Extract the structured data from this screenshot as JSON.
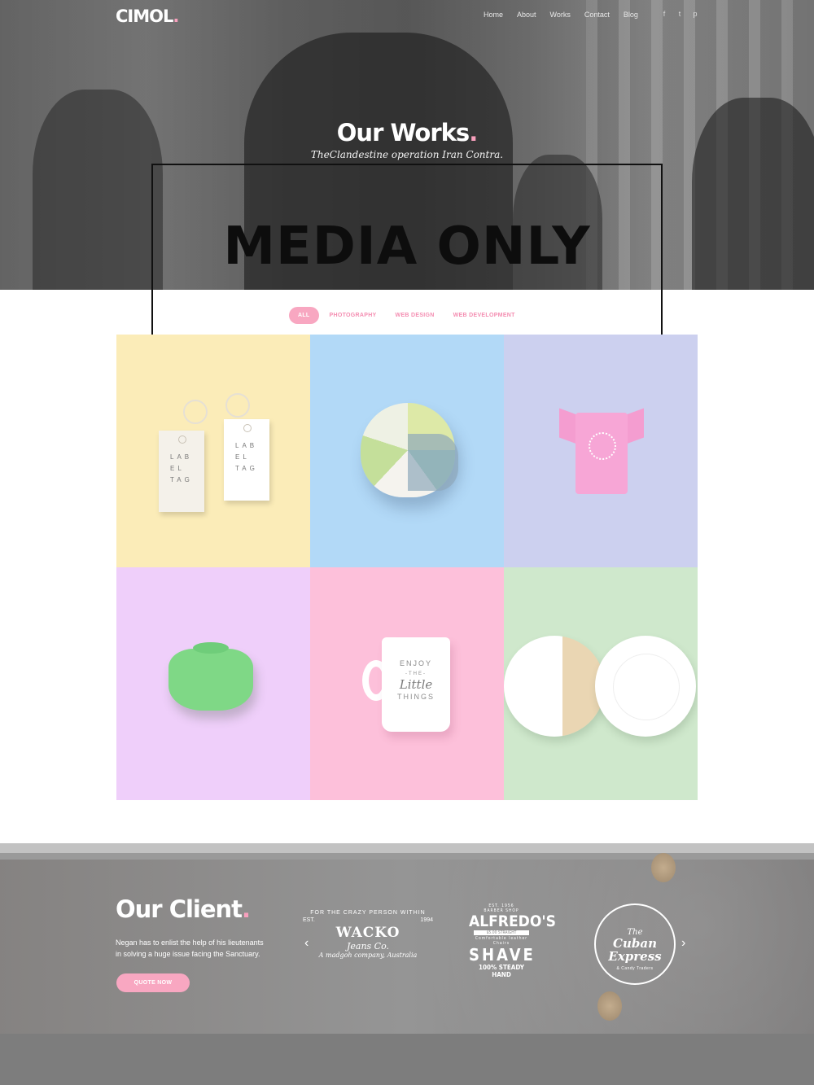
{
  "header": {
    "logo_text": "CIMOL",
    "logo_dot": ".",
    "nav": [
      "Home",
      "About",
      "Works",
      "Contact",
      "Blog"
    ],
    "social_icons": [
      {
        "name": "facebook-icon",
        "glyph": "f"
      },
      {
        "name": "twitter-icon",
        "glyph": "t"
      },
      {
        "name": "pinterest-icon",
        "glyph": "p"
      }
    ]
  },
  "hero": {
    "title": "Our Works",
    "title_dot": ".",
    "subtitle": "TheClandestine operation  Iran Contra."
  },
  "overlay": {
    "label": "MEDIA ONLY"
  },
  "filters": [
    "ALL",
    "PHOTOGRAPHY",
    "WEB DESIGN",
    "WEB DEVELOPMENT"
  ],
  "portfolio": {
    "items": [
      {
        "name": "label-tags",
        "bg": "#fbecb8",
        "tag_text": "LAB EL TAG"
      },
      {
        "name": "helmet",
        "bg": "#b2d9f7"
      },
      {
        "name": "tshirt",
        "bg": "#ccd0ef"
      },
      {
        "name": "drawstring-pouch",
        "bg": "#efcffa"
      },
      {
        "name": "mug",
        "bg": "#fdc0da",
        "mug_top": "ENJOY",
        "mug_the": "-THE-",
        "mug_script": "Little",
        "mug_bottom": "THINGS"
      },
      {
        "name": "plates",
        "bg": "#cfe8cc"
      }
    ]
  },
  "clients": {
    "title": "Our Client",
    "title_dot": ".",
    "text": "Negan has to enlist the help of his lieutenants in solving a huge issue facing the Sanctuary.",
    "button": "QUOTE NOW",
    "logos": {
      "wacko": {
        "arc": "FOR THE CRAZY PERSON WITHIN",
        "est": "EST.",
        "year": "1994",
        "name": "WACKO",
        "sub": "Jeans Co.",
        "tag": "A madgoh company, Australia"
      },
      "alfredo": {
        "est": "EST. 1956",
        "shop": "BARBER SHOP",
        "name": "ALFREDO'S",
        "band": "$5.00 STRAIGHT",
        "small": "Comfortable leather Chairs",
        "shave": "SHAVE",
        "steady": "100% STEADY HAND"
      },
      "cuban": {
        "the": "The",
        "name": "Cuban Express",
        "sub": "& Candy Traders"
      }
    },
    "arrows": {
      "prev": "‹",
      "next": "›"
    }
  },
  "colors": {
    "accent": "#f8a7c1",
    "text_on_dark": "#ffffff"
  }
}
